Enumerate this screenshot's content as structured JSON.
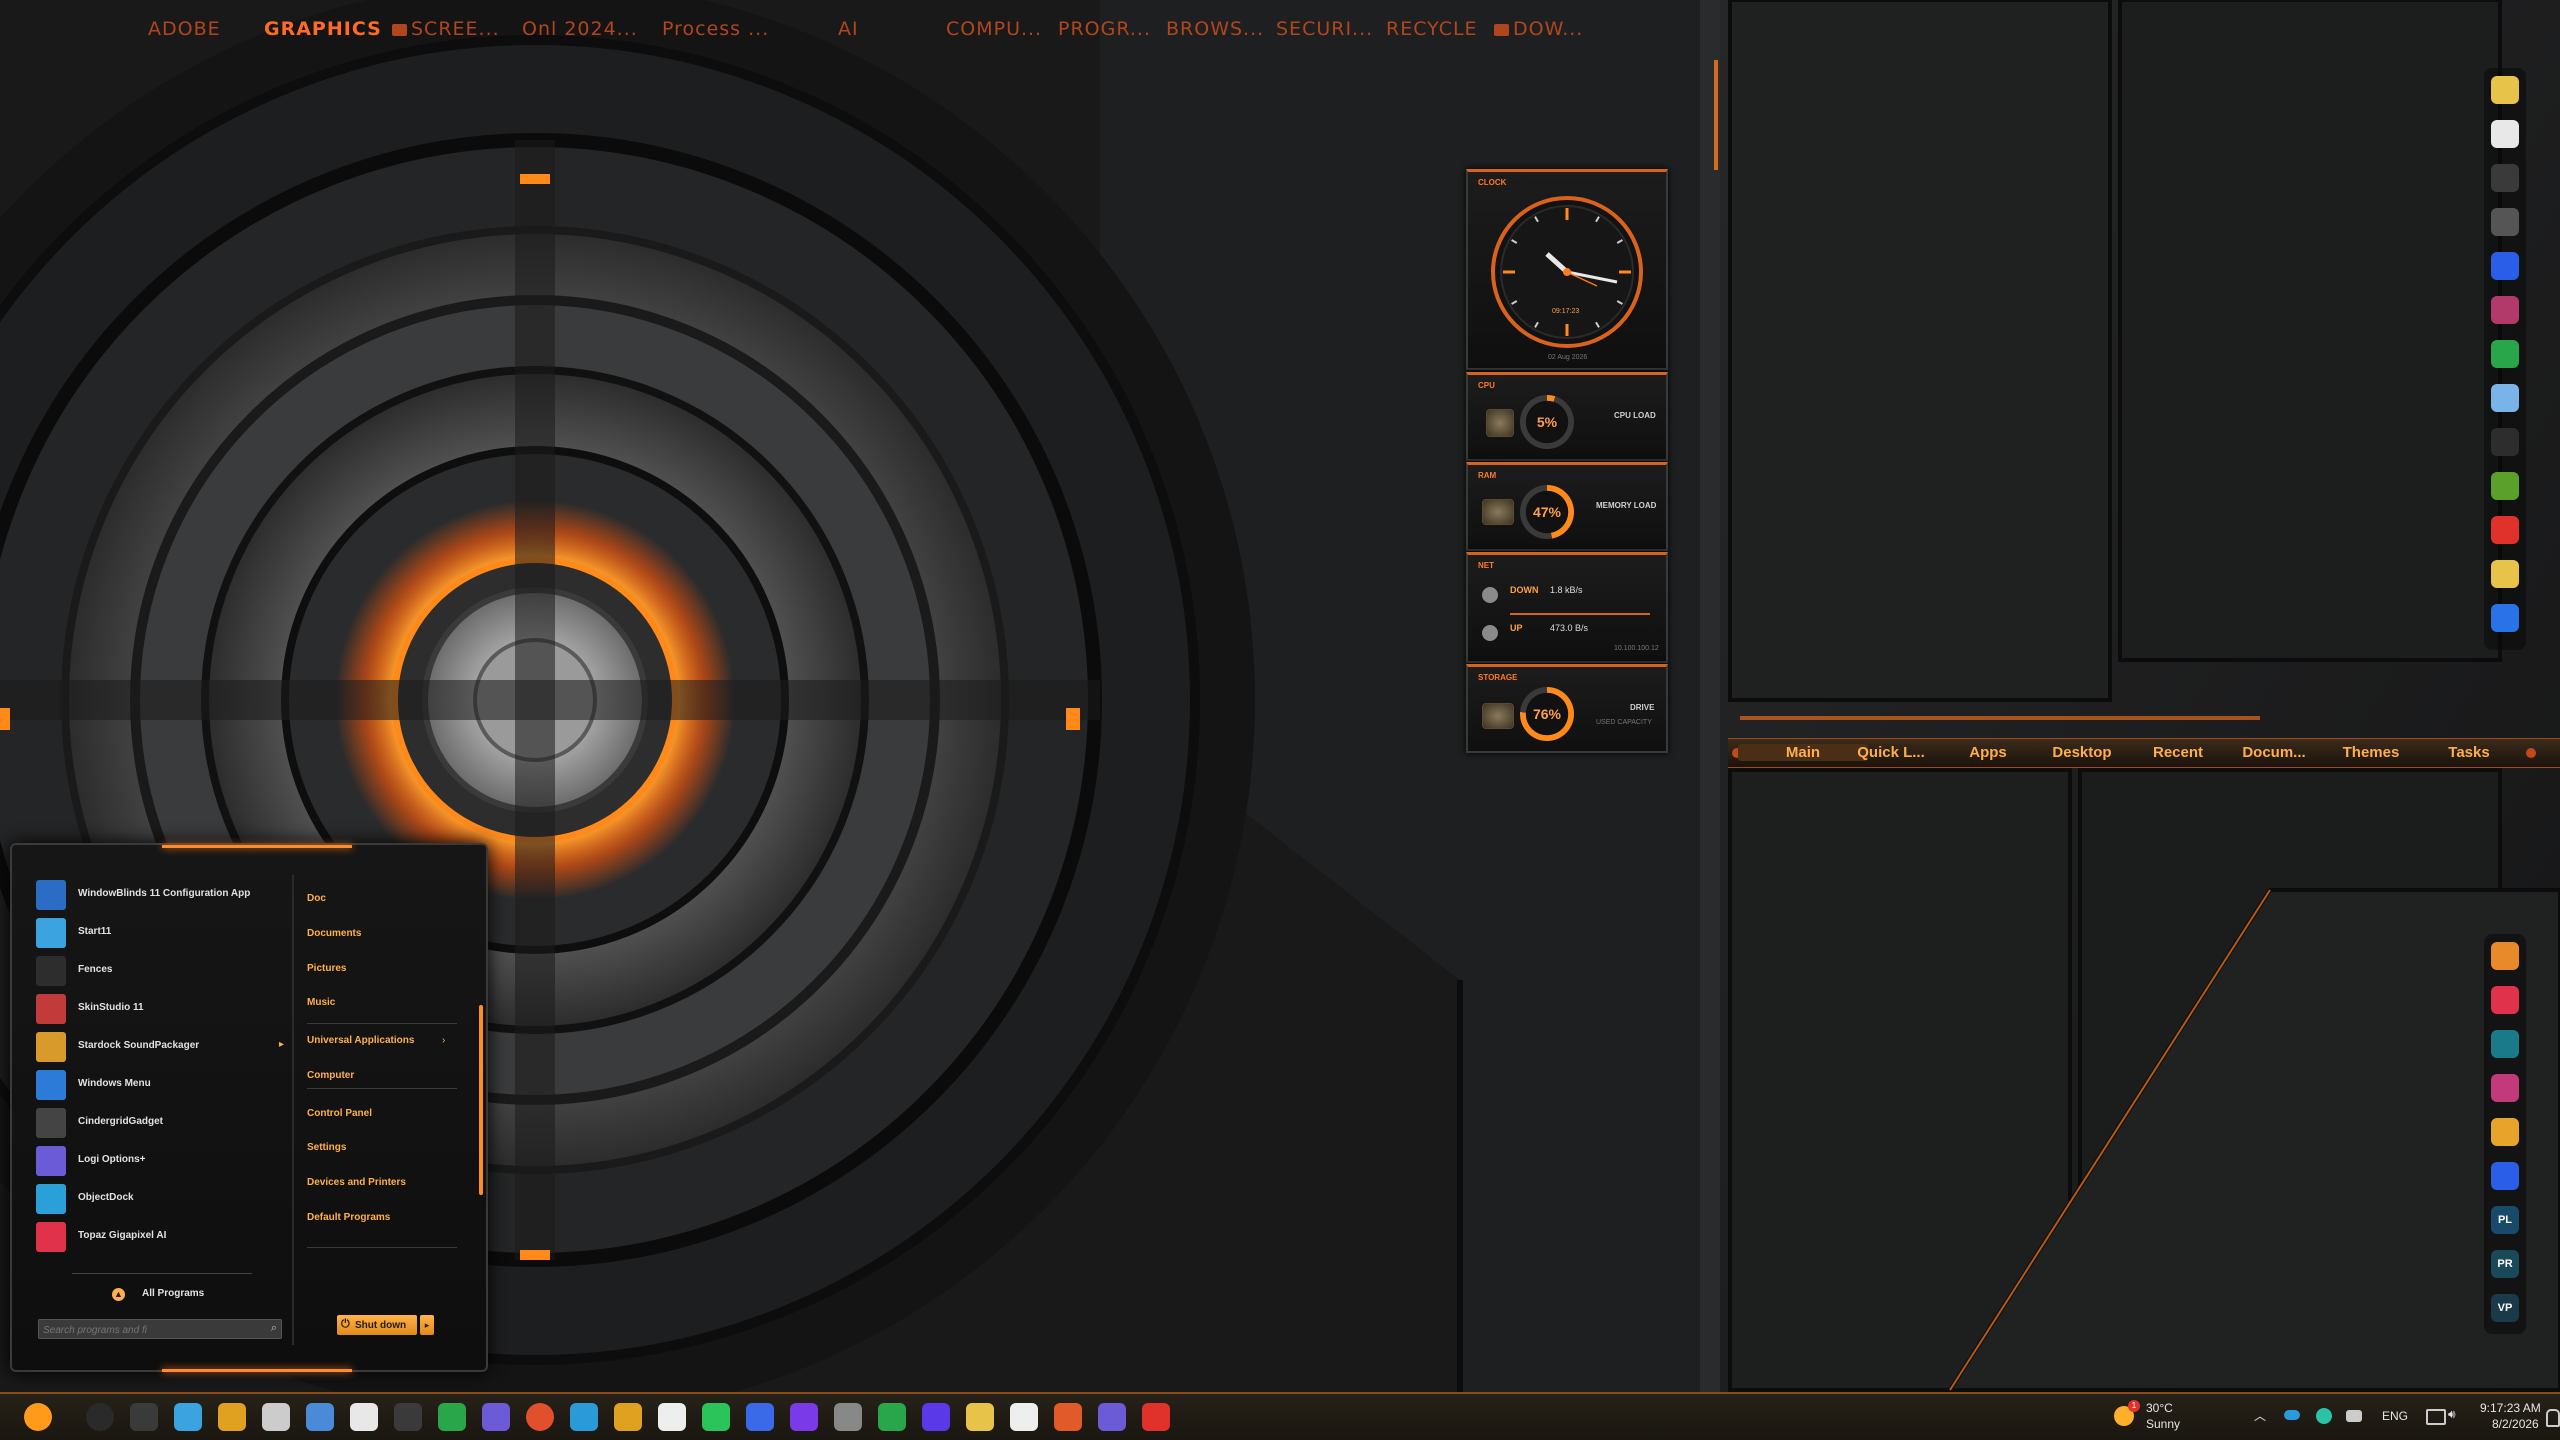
{
  "colors": {
    "accent": "#ff7a1a",
    "accent_dark": "#b1461c",
    "text_orange": "#ffae4d",
    "bg": "#151617"
  },
  "top_fences": [
    {
      "label": "ADOBE"
    },
    {
      "label": "GRAPHICS",
      "active": true
    },
    {
      "label": "SCREE..."
    },
    {
      "label": "Onl 2024..."
    },
    {
      "label": "Process ..."
    },
    {
      "label": "AI"
    },
    {
      "label": "COMPU..."
    },
    {
      "label": "PROGR..."
    },
    {
      "label": "BROWS..."
    },
    {
      "label": "SECURI..."
    },
    {
      "label": "RECYCLE"
    },
    {
      "label": "DOW..."
    }
  ],
  "gadgets": {
    "clock": {
      "title": "CLOCK",
      "time": "09:17:23",
      "date": "02 Aug 2026"
    },
    "cpu": {
      "title": "CPU",
      "value": "5%",
      "label": "CPU LOAD",
      "fraction": 0.05
    },
    "ram": {
      "title": "RAM",
      "value": "47%",
      "label": "MEMORY LOAD",
      "fraction": 0.47
    },
    "net": {
      "title": "NET",
      "down_label": "DOWN",
      "down_value": "1.8 kB/s",
      "up_label": "UP",
      "up_value": "473.0 B/s",
      "note": "10.100.100.12"
    },
    "storage": {
      "title": "STORAGE",
      "value": "76%",
      "label": "DRIVE",
      "sub": "USED CAPACITY",
      "fraction": 0.76
    }
  },
  "panel_tabs": [
    "Main",
    "Quick L...",
    "Apps",
    "Desktop",
    "Recent",
    "Docum...",
    "Themes",
    "Tasks"
  ],
  "start_menu": {
    "apps": [
      {
        "label": "WindowBlinds 11 Configuration App",
        "icon": "windowblinds-icon",
        "color": "#2b6cc4"
      },
      {
        "label": "Start11",
        "icon": "start11-icon",
        "color": "#3aa3e0"
      },
      {
        "label": "Fences",
        "icon": "fences-icon",
        "color": "#2d2d2d"
      },
      {
        "label": "SkinStudio 11",
        "icon": "skinstudio-icon",
        "color": "#c23a3a"
      },
      {
        "label": "Stardock SoundPackager",
        "icon": "soundpackager-icon",
        "color": "#d89a2a",
        "submenu": true
      },
      {
        "label": "Windows Menu",
        "icon": "windows-menu-icon",
        "color": "#2d7bd8"
      },
      {
        "label": "CindergridGadget",
        "icon": "cindergrid-icon",
        "color": "#444444"
      },
      {
        "label": "Logi Options+",
        "icon": "logi-icon",
        "color": "#6b5bd6"
      },
      {
        "label": "ObjectDock",
        "icon": "objectdock-icon",
        "color": "#2aa0d8"
      },
      {
        "label": "Topaz Gigapixel AI",
        "icon": "topaz-icon",
        "color": "#e0324a"
      }
    ],
    "places": [
      "Doc",
      "Documents",
      "Pictures",
      "Music",
      "Universal Applications",
      "Computer",
      "Control Panel",
      "Settings",
      "Devices and Printers",
      "Default Programs"
    ],
    "all_programs": "All Programs",
    "search_placeholder": "Search programs and fi",
    "shutdown": "Shut down"
  },
  "dock_top": [
    {
      "icon": "lightbulb-icon",
      "color": "#e8c34a"
    },
    {
      "icon": "document-icon",
      "color": "#e8e8e8"
    },
    {
      "icon": "rocket-icon",
      "color": "#3a3a3a"
    },
    {
      "icon": "wacom-icon",
      "color": "#555555"
    },
    {
      "icon": "malwarebytes-icon",
      "color": "#2a5ee8"
    },
    {
      "icon": "winrar-icon",
      "color": "#b23a6a"
    },
    {
      "icon": "utorrent-icon",
      "color": "#2aa64a"
    },
    {
      "icon": "cloud-icon",
      "color": "#7ab3e8"
    },
    {
      "icon": "magnifier-icon",
      "color": "#2d2d2d"
    },
    {
      "icon": "nvidia-icon",
      "color": "#5aa02a"
    },
    {
      "icon": "pdf-icon",
      "color": "#e0322a"
    },
    {
      "icon": "weather-icon",
      "color": "#e8c34a"
    },
    {
      "icon": "dropbox-icon",
      "color": "#2a72e8"
    }
  ],
  "dock_bottom": [
    {
      "icon": "photo-editor-icon",
      "color": "#e88a2a"
    },
    {
      "icon": "creative-cloud-icon",
      "color": "#e0324a"
    },
    {
      "icon": "teal-app-icon",
      "color": "#1a7a8a"
    },
    {
      "icon": "instagram-icon",
      "color": "#c23a7a"
    },
    {
      "icon": "sparkle-icon",
      "color": "#e8a42a"
    },
    {
      "icon": "shield-icon",
      "color": "#2a5ee8"
    },
    {
      "icon": "pl-icon",
      "color": "#1a4a6a",
      "text": "PL"
    },
    {
      "icon": "pr-icon",
      "color": "#1a4a5a",
      "text": "PR"
    },
    {
      "icon": "vp-icon",
      "color": "#1a3a4a",
      "text": "VP"
    }
  ],
  "taskbar": {
    "icons": [
      {
        "icon": "start-orb-icon",
        "color": "#ff9a1a"
      },
      {
        "icon": "search-icon",
        "color": "#2a2a2a"
      },
      {
        "icon": "task-view-icon",
        "color": "#3a3a3a"
      },
      {
        "icon": "file-explorer-icon",
        "color": "#3aa3e0"
      },
      {
        "icon": "chrome-icon",
        "color": "#e0a020"
      },
      {
        "icon": "pinned-app-icon",
        "color": "#cccccc"
      },
      {
        "icon": "calculator-icon",
        "color": "#4a8ad8"
      },
      {
        "icon": "paint-drop-icon",
        "color": "#e8e8e8"
      },
      {
        "icon": "launcher-icon",
        "color": "#3a3a3a"
      },
      {
        "icon": "xbox-icon",
        "color": "#2aa64a"
      },
      {
        "icon": "teams-icon",
        "color": "#6b5bd6"
      },
      {
        "icon": "brave-icon",
        "color": "#e0502a"
      },
      {
        "icon": "edge-icon",
        "color": "#2a9ad8"
      },
      {
        "icon": "google-chrome-icon",
        "color": "#e0a020"
      },
      {
        "icon": "media-player-icon",
        "color": "#eeeeee"
      },
      {
        "icon": "whatsapp-icon",
        "color": "#2ac45a"
      },
      {
        "icon": "signal-icon",
        "color": "#3a6ae8"
      },
      {
        "icon": "messenger-icon",
        "color": "#7a3ae8"
      },
      {
        "icon": "wacom-center-icon",
        "color": "#888888"
      },
      {
        "icon": "utorrent-taskbar-icon",
        "color": "#2aa64a"
      },
      {
        "icon": "vpn-icon",
        "color": "#5a3ae8"
      },
      {
        "icon": "chat-icon",
        "color": "#e8c34a"
      },
      {
        "icon": "notepad-icon",
        "color": "#eeeeee"
      },
      {
        "icon": "shell-icon",
        "color": "#e05a2a"
      },
      {
        "icon": "teams-work-icon",
        "color": "#6b5bd6"
      },
      {
        "icon": "anydesk-icon",
        "color": "#e0322a"
      }
    ],
    "weather_temp": "30°C",
    "weather_desc": "Sunny",
    "weather_badge": "1",
    "language": "ENG",
    "time": "9:17:23 AM",
    "date": "8/2/2026"
  }
}
